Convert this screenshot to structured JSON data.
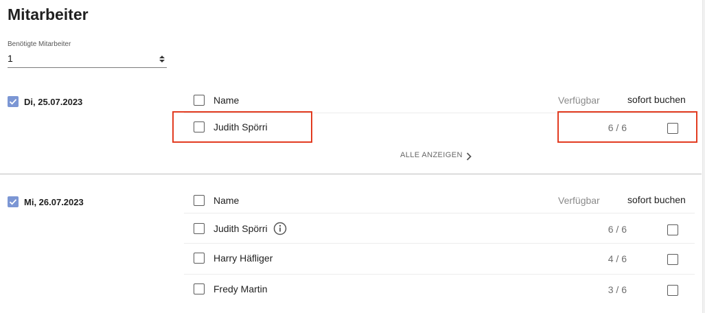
{
  "page": {
    "title": "Mitarbeiter"
  },
  "needed_employees": {
    "label": "Benötigte Mitarbeiter",
    "value": "1"
  },
  "columns": {
    "name": "Name",
    "available": "Verfügbar",
    "book_now": "sofort buchen"
  },
  "days": [
    {
      "date": "Di, 25.07.2023",
      "checked": true,
      "employees": [
        {
          "name": "Judith Spörri",
          "available": "6 / 6",
          "info": false
        }
      ],
      "show_all": "ALLE ANZEIGEN"
    },
    {
      "date": "Mi, 26.07.2023",
      "checked": true,
      "employees": [
        {
          "name": "Judith Spörri",
          "available": "6 / 6",
          "info": true
        },
        {
          "name": "Harry Häfliger",
          "available": "4 / 6",
          "info": false
        },
        {
          "name": "Fredy Martin",
          "available": "3 / 6",
          "info": false
        }
      ]
    }
  ],
  "colors": {
    "checkbox_checked": "#7b96d4",
    "highlight": "#e23a1f"
  }
}
